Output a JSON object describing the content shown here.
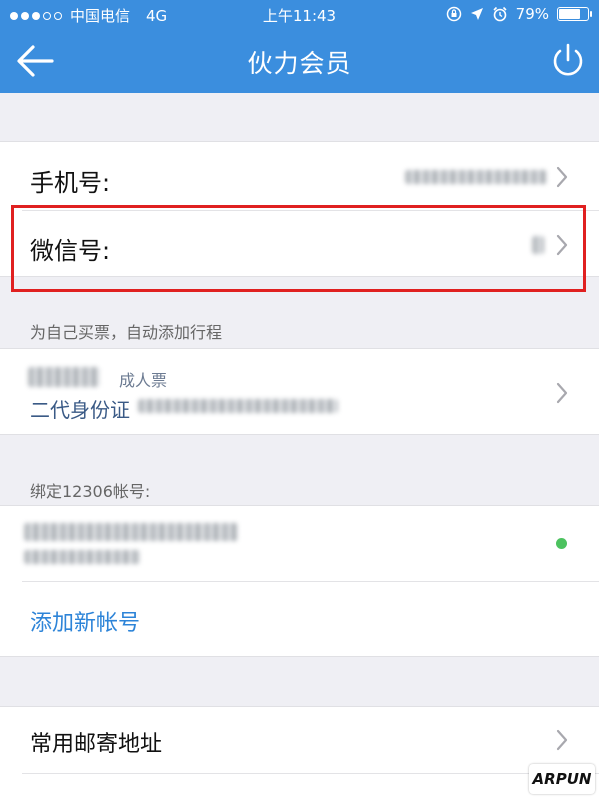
{
  "status_bar": {
    "carrier": "中国电信",
    "network": "4G",
    "time": "上午11:43",
    "battery": "79%",
    "battery_level": 0.79
  },
  "nav": {
    "title": "伙力会员",
    "back_icon": "back-arrow-icon",
    "power_icon": "power-icon"
  },
  "account": {
    "phone_label": "手机号:",
    "wechat_label": "微信号:"
  },
  "self_ticket": {
    "hint": "为自己买票，自动添加行程",
    "ticket_type": "成人票",
    "id_type": "二代身份证"
  },
  "bind_12306": {
    "hint": "绑定12306帐号:",
    "add_account": "添加新帐号"
  },
  "mail": {
    "address_label": "常用邮寄地址"
  },
  "watermark": "ARPUN",
  "colors": {
    "nav_blue": "#3b8ede",
    "link_blue": "#2d84d8",
    "highlight_red": "#e02020",
    "status_green": "#4cc25f"
  }
}
